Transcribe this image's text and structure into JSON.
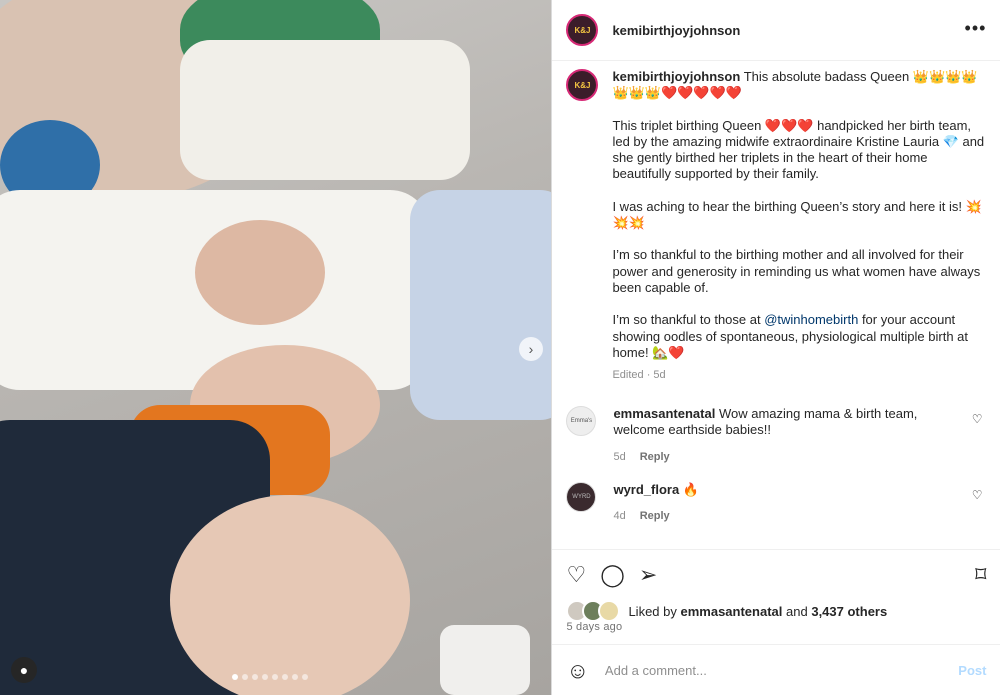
{
  "post": {
    "username": "kemibirthjoyjohnson",
    "avatar_text": "K&J",
    "more_icon": "more-icon",
    "caption_user": "kemibirthjoyjohnson",
    "caption_p1": "This absolute badass Queen 👑👑👑👑👑👑👑❤️❤️❤️❤️❤️",
    "caption_p2": "This triplet birthing Queen ❤️❤️❤️ handpicked her birth team, led by the amazing midwife extraordinaire Kristine Lauria 💎 and she gently birthed her triplets in the heart of their home beautifully supported by their family.",
    "caption_p3": "I was aching to hear the birthing Queen’s story and here it is! 💥💥💥",
    "caption_p4": "I’m so thankful to the birthing mother and all involved for their power and generosity in reminding us what women have always been capable of.",
    "caption_p5_a": "I’m so thankful to those at ",
    "caption_p5_mention": "@twinhomebirth",
    "caption_p5_b": " for your account showing oodles of spontaneous, physiological multiple birth at home! 🏡❤️",
    "edited": "Edited · 5d"
  },
  "comments": [
    {
      "user": "emmasantenatal",
      "avatar_text": "Emma's",
      "text": "Wow amazing mama & birth team, welcome earthside babies!!",
      "time": "5d",
      "reply": "Reply"
    },
    {
      "user": "wyrd_flora",
      "avatar_text": "WYRD",
      "text": "🔥",
      "time": "4d",
      "reply": "Reply"
    }
  ],
  "actions": {
    "like_icon": "heart-icon",
    "comment_icon": "comment-icon",
    "share_icon": "share-icon",
    "save_icon": "bookmark-icon"
  },
  "likes": {
    "prefix": "Liked by",
    "user": "emmasantenatal",
    "mid": "and",
    "count": "3,437 others"
  },
  "age": "5 days ago",
  "add_comment": {
    "placeholder": "Add a comment...",
    "post_label": "Post"
  },
  "carousel": {
    "slides": 8,
    "active": 1
  },
  "colors": {
    "link": "#00376b",
    "post_disabled": "#b3dbff",
    "ring": "#d62976"
  }
}
